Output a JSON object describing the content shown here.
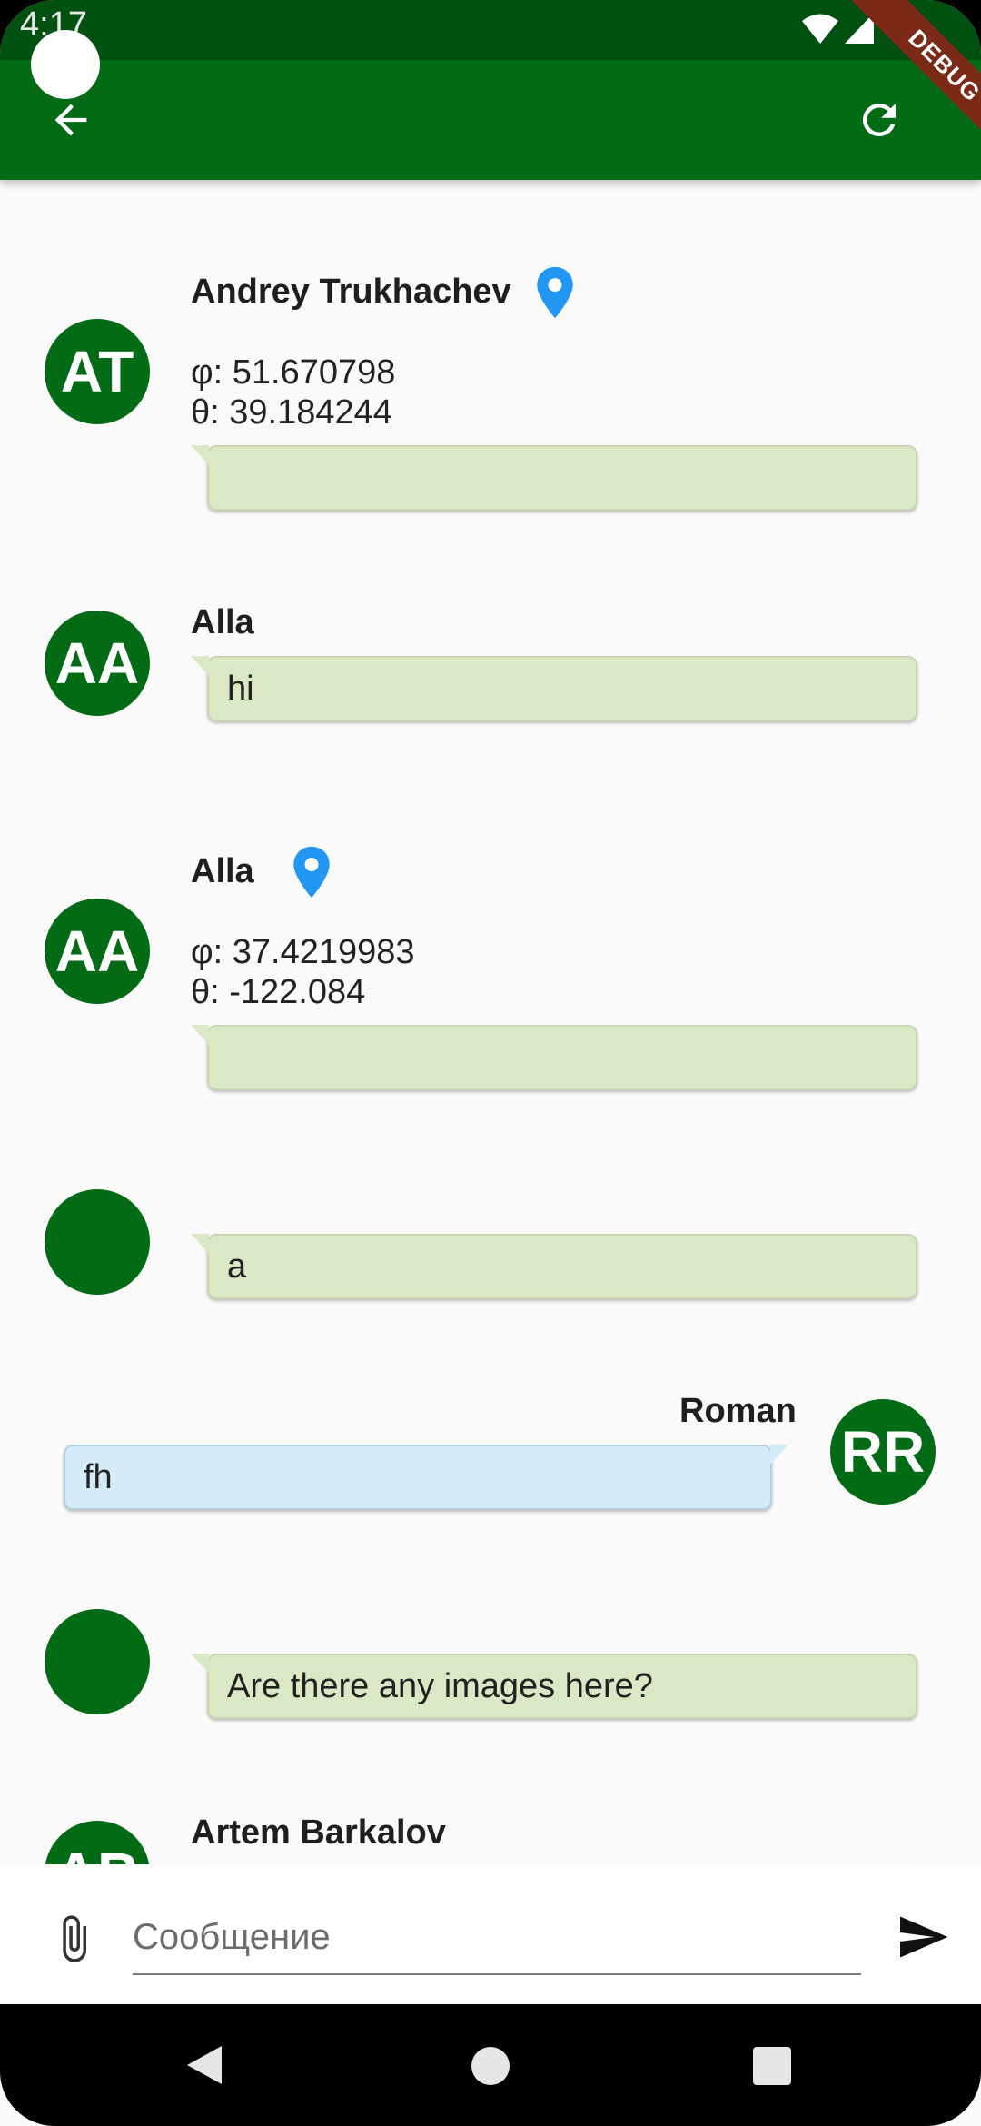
{
  "status": {
    "time": "4:17"
  },
  "debug_banner": "DEBUG",
  "messages": [
    {
      "initials": "AT",
      "name": "Andrey Trukhachev",
      "has_location": true,
      "lat": "φ: 51.670798",
      "lon": "θ: 39.184244",
      "text": ""
    },
    {
      "initials": "AA",
      "name": "Alla",
      "has_location": false,
      "text": "hi"
    },
    {
      "initials": "AA",
      "name": "Alla",
      "has_location": true,
      "lat": "φ: 37.4219983",
      "lon": "θ: -122.084",
      "text": ""
    },
    {
      "initials": "",
      "name": "",
      "has_location": false,
      "text": "a"
    },
    {
      "initials": "RR",
      "name": "Roman",
      "has_location": false,
      "text": "fh",
      "outgoing": true
    },
    {
      "initials": "",
      "name": "",
      "has_location": false,
      "text": "Are there any images here?"
    },
    {
      "initials": "AB",
      "name": "Artem Barkalov",
      "has_location": false,
      "text": ""
    }
  ],
  "composer": {
    "placeholder": "Сообщение"
  },
  "colors": {
    "appbar": "#036a15",
    "statusbar": "#00500f",
    "avatar": "#036a15",
    "incoming_bubble": "#dbe8c5",
    "outgoing_bubble": "#d4ecf7",
    "location_pin": "#2196f3"
  }
}
